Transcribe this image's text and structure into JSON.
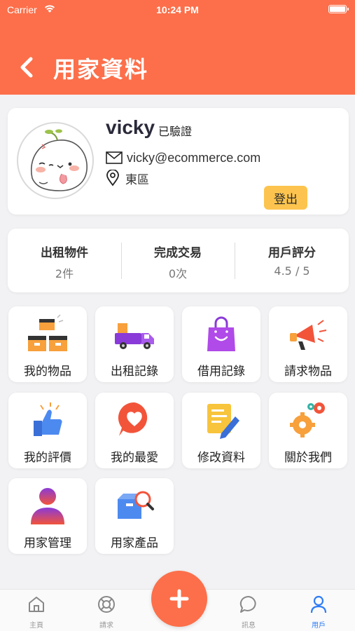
{
  "status_bar": {
    "carrier": "Carrier",
    "time": "10:24 PM"
  },
  "header": {
    "title": "用家資料"
  },
  "profile": {
    "username": "vicky",
    "verified_label": "已驗證",
    "email": "vicky@ecommerce.com",
    "district": "東區",
    "logout_label": "登出"
  },
  "stats": [
    {
      "label": "出租物件",
      "value": "2件"
    },
    {
      "label": "完成交易",
      "value": "0次"
    },
    {
      "label": "用戶評分",
      "value": "4.5 / 5"
    }
  ],
  "menu": [
    {
      "label": "我的物品",
      "icon": "boxes-icon"
    },
    {
      "label": "出租記錄",
      "icon": "delivery-truck-icon"
    },
    {
      "label": "借用記錄",
      "icon": "shopping-bag-icon"
    },
    {
      "label": "請求物品",
      "icon": "megaphone-icon"
    },
    {
      "label": "我的評價",
      "icon": "thumbs-up-icon"
    },
    {
      "label": "我的最愛",
      "icon": "heart-bubble-icon"
    },
    {
      "label": "修改資料",
      "icon": "edit-note-icon"
    },
    {
      "label": "關於我們",
      "icon": "gears-icon"
    },
    {
      "label": "用家管理",
      "icon": "user-silhouette-icon"
    },
    {
      "label": "用家產品",
      "icon": "product-search-icon"
    }
  ],
  "tabbar": {
    "tabs": [
      {
        "label": "主頁",
        "icon": "home-icon"
      },
      {
        "label": "請求",
        "icon": "lifebuoy-icon"
      },
      {
        "label": "訊息",
        "icon": "chat-bubble-icon"
      },
      {
        "label": "用戶",
        "icon": "user-icon"
      }
    ],
    "active_color": "#2f7df6",
    "inactive_color": "#999999"
  },
  "colors": {
    "accent": "#fc6f4a",
    "logout": "#fcc44e"
  }
}
